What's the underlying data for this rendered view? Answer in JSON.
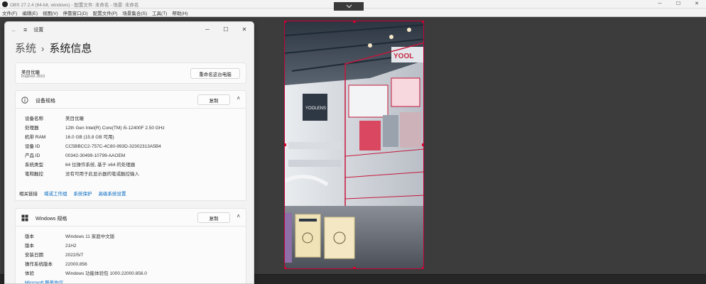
{
  "obs": {
    "title": "OBS 27.2.4 (64-bit, windows) - 配置文件: 未命名 - 场景: 未命名",
    "menu": [
      "文件(F)",
      "编辑(E)",
      "视图(V)",
      "停靠窗口(D)",
      "配置文件(P)",
      "场景集合(S)",
      "工具(T)",
      "帮助(H)"
    ],
    "collapse_icon": "chevron-down",
    "window_controls": [
      "─",
      "☐",
      "✕"
    ]
  },
  "settings": {
    "title": "设置",
    "back_icon": "←",
    "hamburger_icon": "≡",
    "window_controls": [
      "─",
      "☐",
      "✕"
    ],
    "breadcrumb_parent": "系统",
    "breadcrumb_sep": "›",
    "breadcrumb_current": "系统信息",
    "device_card": {
      "name": "美目优瞳",
      "model": "Inspiron 3910",
      "rename_button": "重命名这台电脑"
    },
    "device_specs": {
      "title": "设备规格",
      "copy_button": "复制",
      "chevron": "˄",
      "rows": [
        {
          "label": "设备名称",
          "value": "美目优瞳"
        },
        {
          "label": "处理器",
          "value": "12th Gen Intel(R) Core(TM) i5-12400F   2.50 GHz"
        },
        {
          "label": "机带 RAM",
          "value": "16.0 GB (15.8 GB 可用)"
        },
        {
          "label": "设备 ID",
          "value": "CC5BBCC2-757C-4C80-993D-32302313A5B4"
        },
        {
          "label": "产品 ID",
          "value": "00342-30499-10799-AAOEM"
        },
        {
          "label": "系统类型",
          "value": "64 位操作系统, 基于 x64 的处理器"
        },
        {
          "label": "笔和触控",
          "value": "没有可用于此显示器的笔或触控输入"
        }
      ]
    },
    "related": {
      "label": "相关链接",
      "links": [
        "域或工作组",
        "系统保护",
        "高级系统设置"
      ]
    },
    "windows_specs": {
      "title": "Windows 规格",
      "copy_button": "复制",
      "chevron": "˄",
      "rows": [
        {
          "label": "版本",
          "value": "Windows 11 家庭中文版"
        },
        {
          "label": "版本",
          "value": "21H2"
        },
        {
          "label": "安装日期",
          "value": "2022/5/7"
        },
        {
          "label": "操作系统版本",
          "value": "22000.856"
        },
        {
          "label": "体验",
          "value": "Windows 功能体验包 1000.22000.856.0"
        }
      ],
      "ms_link": "Microsoft 服务协议"
    }
  },
  "colors": {
    "obs_bg": "#3c3c3c",
    "accent_link": "#0067c0",
    "selection_red": "#e0002a"
  }
}
